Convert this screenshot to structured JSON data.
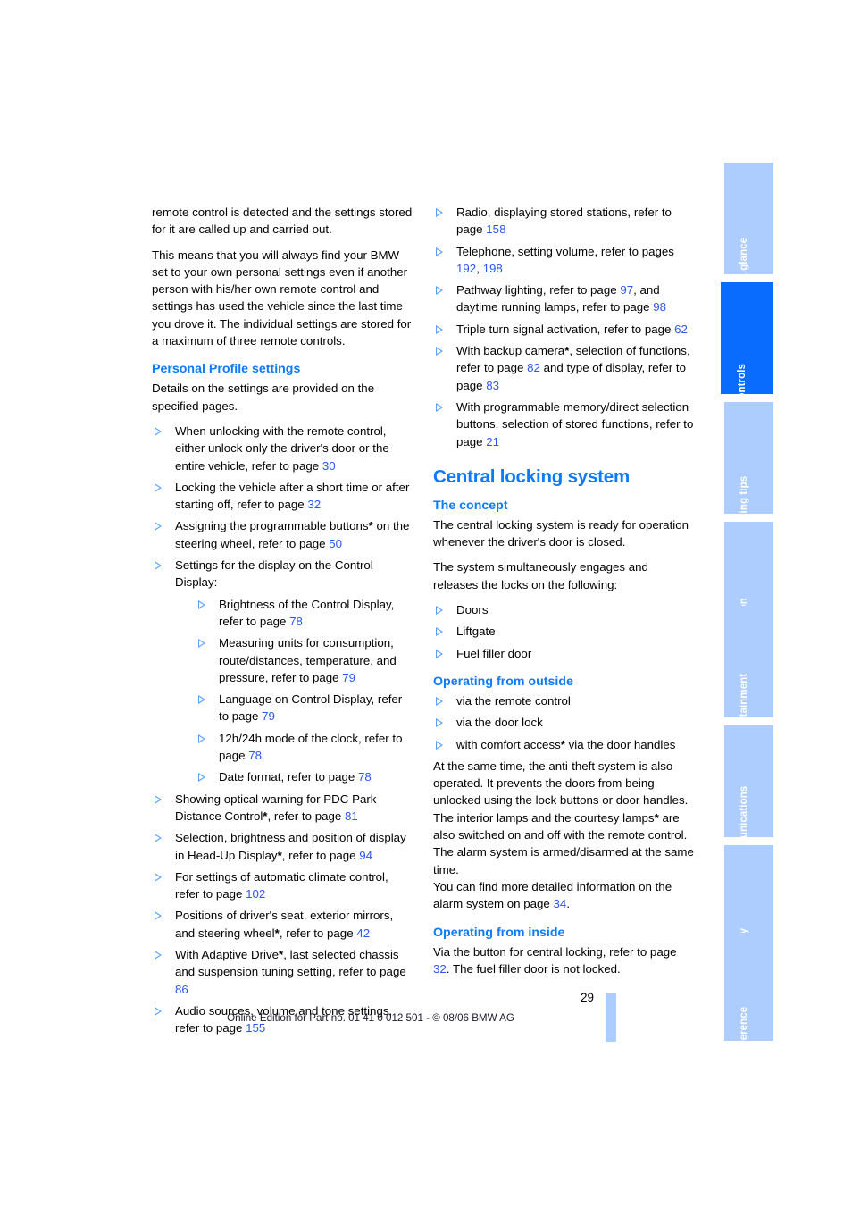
{
  "document": {
    "page_number": "29",
    "footer_note": "Online Edition for Part no. 01 41 0 012 501 - © 08/06 BMW AG"
  },
  "tabs": [
    {
      "label": "At a glance",
      "active": false
    },
    {
      "label": "Controls",
      "active": true
    },
    {
      "label": "Driving tips",
      "active": false
    },
    {
      "label": "Navigation",
      "active": false
    },
    {
      "label": "Entertainment",
      "active": false
    },
    {
      "label": "Communications",
      "active": false
    },
    {
      "label": "Mobility",
      "active": false
    },
    {
      "label": "Reference",
      "active": false
    }
  ],
  "colors": {
    "heading_blue": "#0a7bfc",
    "page_ref_blue": "#2b57f5",
    "tab_inactive": "#aecdff",
    "tab_active": "#0a6cff",
    "bullet_blue": "#4e9bff"
  },
  "left_column": {
    "intro_para_1": "remote control is detected and the settings stored for it are called up and carried out.",
    "intro_para_2": "This means that you will always find your BMW set to your own personal settings even if another person with his/her own remote control and settings has used the vehicle since the last time you drove it. The individual settings are stored for a maximum of three remote controls.",
    "heading": "Personal Profile settings",
    "lead": "Details on the settings are provided on the specified pages.",
    "bullets": [
      {
        "text_before": "When unlocking with the remote control, either unlock only the driver's door or the entire vehicle, refer to page ",
        "page": "30",
        "text_after": ""
      },
      {
        "text_before": "Locking the vehicle after a short time or after starting off, refer to page ",
        "page": "32",
        "text_after": ""
      },
      {
        "text_before": "Assigning the programmable buttons* on the steering wheel, refer to page ",
        "page": "50",
        "text_after": ""
      },
      {
        "text_before": "Settings for the display on the Control Display:",
        "page": "",
        "text_after": ""
      }
    ],
    "nested_bullets": [
      {
        "text_before": "Brightness of the Control Display, refer to page ",
        "page": "78",
        "text_after": ""
      },
      {
        "text_before": "Measuring units for consumption, route/distances, temperature, and pressure, refer to page ",
        "page": "79",
        "text_after": ""
      },
      {
        "text_before": "Language on Control Display, refer to page ",
        "page": "79",
        "text_after": ""
      },
      {
        "text_before": "12h/24h mode of the clock, refer to page ",
        "page": "78",
        "text_after": ""
      },
      {
        "text_before": "Date format, refer to page ",
        "page": "78",
        "text_after": ""
      }
    ],
    "bullets_cont": [
      {
        "text_before": "Showing optical warning for PDC Park Distance Control*, refer to page ",
        "page": "81",
        "text_after": ""
      },
      {
        "text_before": "Selection, brightness and position of display in Head-Up Display*, refer to page ",
        "page": "94",
        "text_after": ""
      },
      {
        "text_before": "For settings of automatic climate control, refer to page ",
        "page": "102",
        "text_after": ""
      },
      {
        "text_before": "Positions of driver's seat, exterior mirrors, and steering wheel*, refer to page ",
        "page": "42",
        "text_after": ""
      },
      {
        "text_before": "With Adaptive Drive*, last selected chassis and suspension tuning setting, refer to page ",
        "page": "86",
        "text_after": ""
      },
      {
        "text_before": "Audio sources, volume and tone settings, refer to page ",
        "page": "155",
        "text_after": ""
      }
    ]
  },
  "right_column": {
    "bullets_top": [
      {
        "text_before": "Radio, displaying stored stations, refer to page ",
        "page": "158",
        "text_after": ""
      },
      {
        "text_before": "Telephone, setting volume, refer to pages ",
        "page": "192",
        "page2": "198",
        "text_after": ""
      },
      {
        "text_before": "Pathway lighting, refer to page ",
        "page": "97",
        "text_mid": ", and daytime running lamps, refer to page ",
        "page2": "98",
        "text_after": ""
      },
      {
        "text_before": "Triple turn signal activation, refer to page ",
        "page": "62",
        "text_after": ""
      },
      {
        "text_before": "With backup camera*, selection of functions, refer to page ",
        "page": "82",
        "text_mid": " and type of display, refer to page ",
        "page2": "83",
        "text_after": ""
      },
      {
        "text_before": "With programmable memory/direct selection buttons, selection of stored functions, refer to page ",
        "page": "21",
        "text_after": ""
      }
    ],
    "section_title": "Central locking system",
    "concept": {
      "heading": "The concept",
      "para_1": "The central locking system is ready for operation whenever the driver's door is closed.",
      "para_2": "The system simultaneously engages and releases the locks on the following:",
      "items": [
        "Doors",
        "Liftgate",
        "Fuel filler door"
      ]
    },
    "outside": {
      "heading": "Operating from outside",
      "items": [
        "via the remote control",
        "via the door lock",
        "with comfort access* via the door handles"
      ],
      "para_1": "At the same time, the anti-theft system is also operated. It prevents the doors from being unlocked using the lock buttons or door handles. The interior lamps and the courtesy lamps* are also switched on and off with the remote control. The alarm system is armed/disarmed at the same time.",
      "para_2_before": "You can find more detailed information on the alarm system on page ",
      "para_2_page": "34",
      "para_2_after": "."
    },
    "inside": {
      "heading": "Operating from inside",
      "para_before": "Via the button for central locking, refer to page ",
      "para_page": "32",
      "para_after": ". The fuel filler door is not locked."
    }
  }
}
